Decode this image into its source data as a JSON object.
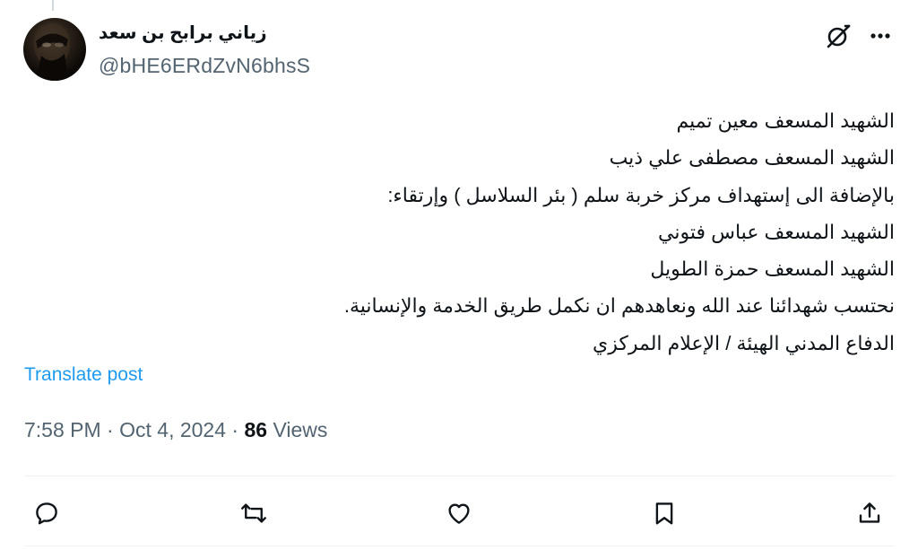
{
  "author": {
    "display_name": "زياني برابح بن سعد",
    "handle": "@bHE6ERdZvN6bhsS"
  },
  "header_icons": {
    "grok": "grok-icon",
    "more": "more-icon"
  },
  "tweet": {
    "lines": [
      "الشهيد المسعف معين تميم",
      "الشهيد المسعف مصطفى علي ذيب",
      "بالإضافة الى إستهداف مركز خربة سلم ( بئر السلاسل ) وإرتقاء:",
      "الشهيد المسعف عباس فتوني",
      "الشهيد المسعف حمزة الطويل",
      "نحتسب شهدائنا عند الله ونعاهدهم ان نكمل طريق الخدمة والإنسانية.",
      "الدفاع المدني الهيئة / الإعلام المركزي"
    ],
    "translate_label": "Translate post"
  },
  "meta": {
    "time": "7:58 PM",
    "separator1": " · ",
    "date": "Oct 4, 2024",
    "separator2": " · ",
    "views_count": "86",
    "views_label": " Views"
  },
  "actions": {
    "reply": "reply-icon",
    "repost": "repost-icon",
    "like": "heart-icon",
    "bookmark": "bookmark-icon",
    "share": "share-icon"
  },
  "colors": {
    "link": "#1d9bf0",
    "secondary_text": "#536471",
    "primary_text": "#0f1419"
  }
}
